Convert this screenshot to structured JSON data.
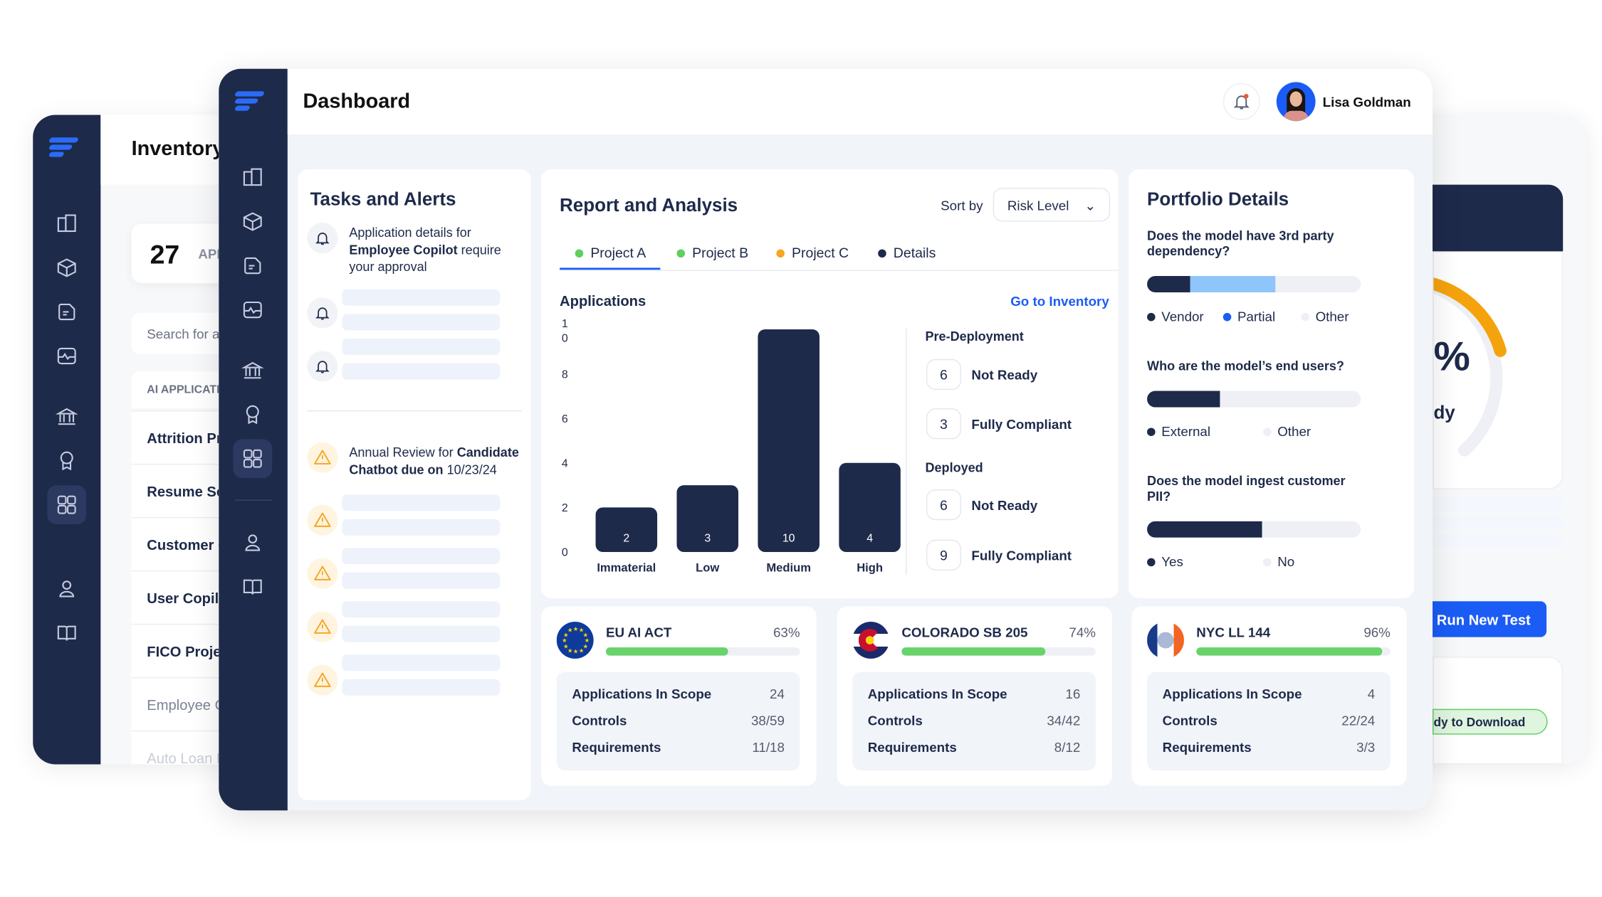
{
  "back_window": {
    "title": "Inventory",
    "count": "27",
    "count_label": "APP",
    "search_placeholder": "Search for a",
    "table_header": "AI APPLICATI",
    "rows": [
      "Attrition Pre",
      "Resume Scr",
      "Customer C",
      "User Copilo",
      "FICO Projec",
      "Employee C",
      "Auto Loan M"
    ],
    "gauge_text": "%",
    "gauge_sub": "dy",
    "run_button": "Run New Test",
    "download_badge": "dy to Download"
  },
  "header": {
    "title": "Dashboard",
    "user_name": "Lisa Goldman"
  },
  "sidebar_icons": [
    "building-icon",
    "cube-icon",
    "document-icon",
    "monitor-icon",
    "bank-icon",
    "award-icon",
    "dashboard-icon",
    "user-icon",
    "book-icon"
  ],
  "tasks": {
    "title": "Tasks and Alerts",
    "alert1": {
      "pre": "Application details for ",
      "bold": "Employee Copilot",
      "post": " require your approval"
    },
    "alert2": {
      "pre": "Annual Review for ",
      "bold": "Candidate Chatbot due on",
      "post": " 10/23/24"
    }
  },
  "report": {
    "title": "Report and Analysis",
    "sort_label": "Sort by",
    "sort_value": "Risk Level",
    "tabs": [
      {
        "label": "Project A",
        "color": "#5fcf5f"
      },
      {
        "label": "Project B",
        "color": "#5fcf5f"
      },
      {
        "label": "Project C",
        "color": "#f5a623"
      },
      {
        "label": "Details",
        "color": "#1e2a4a"
      }
    ],
    "section": "Applications",
    "link": "Go to Inventory",
    "pre_deployment": {
      "title": "Pre-Deployment",
      "not_ready": "6",
      "not_ready_label": "Not Ready",
      "compliant": "3",
      "compliant_label": "Fully Compliant"
    },
    "deployed": {
      "title": "Deployed",
      "not_ready": "6",
      "not_ready_label": "Not Ready",
      "compliant": "9",
      "compliant_label": "Fully Compliant"
    }
  },
  "chart_data": {
    "type": "bar",
    "categories": [
      "Immaterial",
      "Low",
      "Medium",
      "High"
    ],
    "values": [
      2,
      3,
      10,
      4
    ],
    "yticks": [
      "0",
      "2",
      "4",
      "6",
      "8",
      "10"
    ],
    "ylim": [
      0,
      10
    ],
    "color": "#1e2a4a",
    "grid": false
  },
  "portfolio": {
    "title": "Portfolio Details",
    "questions": [
      {
        "q": "Does the model have 3rd party dependency?",
        "segments": [
          {
            "label": "Vendor",
            "value": 20,
            "color": "#1e2a4a"
          },
          {
            "label": "Partial",
            "value": 40,
            "color": "#8ec5fb"
          },
          {
            "label": "Other",
            "value": 40,
            "color": "#eef0f5"
          }
        ],
        "legend_colors": [
          "#1e2a4a",
          "#1a5cf5",
          "#eef0f5"
        ]
      },
      {
        "q": "Who are the model’s end users?",
        "segments": [
          {
            "label": "External",
            "value": 34,
            "color": "#1e2a4a"
          },
          {
            "label": "Other",
            "value": 66,
            "color": "#eef0f5"
          }
        ],
        "legend_colors": [
          "#1e2a4a",
          "#eef0f5"
        ]
      },
      {
        "q": "Does the model ingest customer PII?",
        "segments": [
          {
            "label": "Yes",
            "value": 54,
            "color": "#1e2a4a"
          },
          {
            "label": "No",
            "value": 46,
            "color": "#eef0f5"
          }
        ],
        "legend_colors": [
          "#1e2a4a",
          "#eef0f5"
        ]
      }
    ]
  },
  "compliance": [
    {
      "name": "EU AI ACT",
      "pct": "63%",
      "progress": 63,
      "apps_label": "Applications In Scope",
      "apps": "24",
      "controls_label": "Controls",
      "controls": "38/59",
      "req_label": "Requirements",
      "req": "11/18"
    },
    {
      "name": "COLORADO SB 205",
      "pct": "74%",
      "progress": 74,
      "apps_label": "Applications In Scope",
      "apps": "16",
      "controls_label": "Controls",
      "controls": "34/42",
      "req_label": "Requirements",
      "req": "8/12"
    },
    {
      "name": "NYC LL 144",
      "pct": "96%",
      "progress": 96,
      "apps_label": "Applications In Scope",
      "apps": "4",
      "controls_label": "Controls",
      "controls": "22/24",
      "req_label": "Requirements",
      "req": "3/3"
    }
  ]
}
